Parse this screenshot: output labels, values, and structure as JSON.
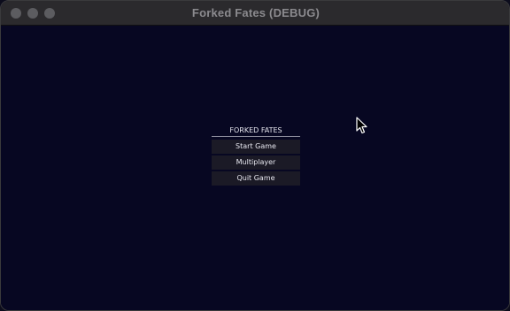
{
  "window": {
    "title": "Forked Fates (DEBUG)"
  },
  "menu": {
    "title": "FORKED FATES",
    "buttons": [
      {
        "label": "Start Game"
      },
      {
        "label": "Multiplayer"
      },
      {
        "label": "Quit Game"
      }
    ]
  },
  "colors": {
    "background": "#070722",
    "button": "#1b1a26",
    "titlebar": "#2b2a2d"
  },
  "icons": {
    "cursor": "arrow-cursor-icon"
  }
}
